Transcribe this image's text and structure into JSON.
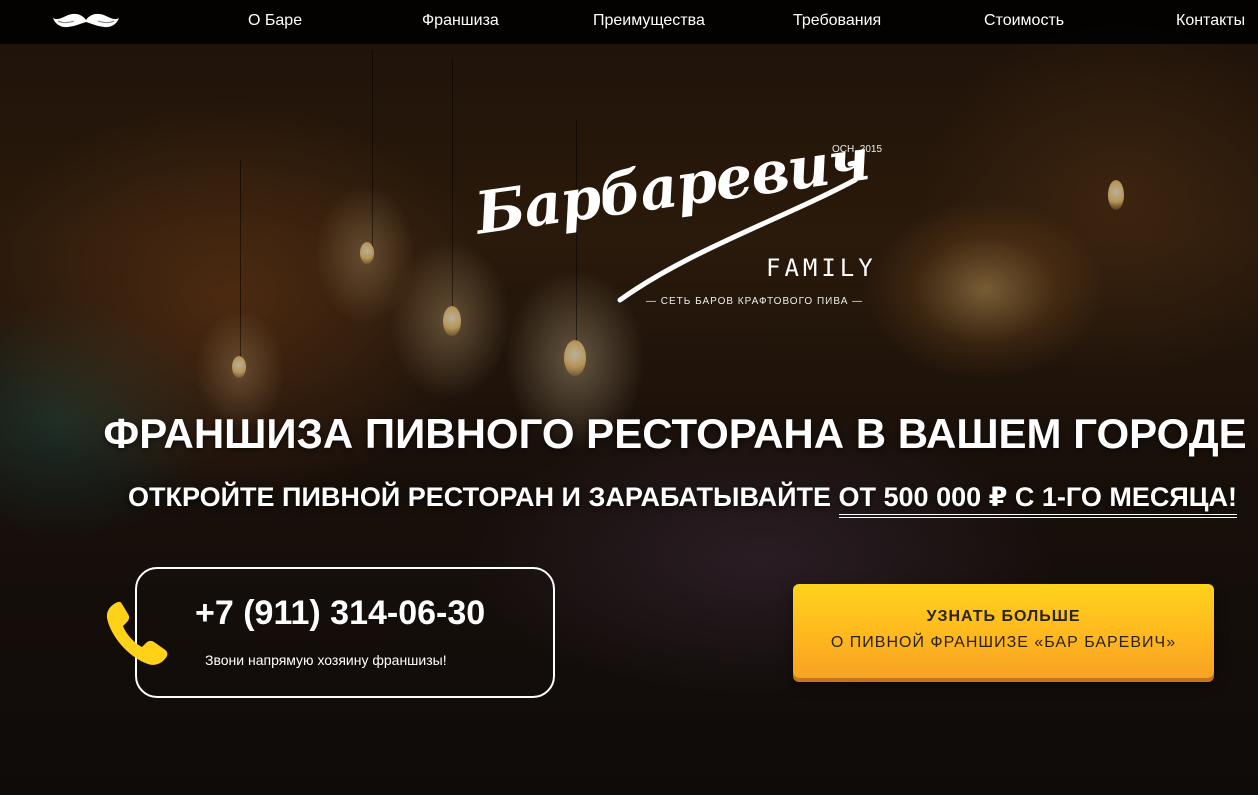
{
  "nav": {
    "items": [
      {
        "label": "О Баре"
      },
      {
        "label": "Франшиза"
      },
      {
        "label": "Преимущества"
      },
      {
        "label": "Требования"
      },
      {
        "label": "Стоимость"
      },
      {
        "label": "Контакты"
      }
    ],
    "logo_icon": "mustache-icon"
  },
  "brand": {
    "script_name": "Барбаревич",
    "established": "ОСН. 2015",
    "family": "FAMILY",
    "tagline": "— СЕТЬ БАРОВ КРАФТОВОГО ПИВА —"
  },
  "hero": {
    "headline": "ФРАНШИЗА ПИВНОГО РЕСТОРАНА В ВАШЕМ ГОРОДЕ",
    "sub_prefix": "ОТКРОЙТЕ ПИВНОЙ РЕСТОРАН И ЗАРАБАТЫВАЙТЕ ",
    "sub_highlight": "ОТ 500 000 ₽ С 1-ГО МЕСЯЦА!"
  },
  "contact": {
    "phone": "+7 (911) 314-06-30",
    "note": "Звони напрямую хозяину франшизы!",
    "icon": "phone-icon"
  },
  "cta": {
    "line1": "УЗНАТЬ БОЛЬШЕ",
    "line2": "О ПИВНОЙ ФРАНШИЗЕ «БАР БАРЕВИЧ»"
  },
  "colors": {
    "accent": "#ffc21f",
    "phone_icon": "#ffd21a",
    "nav_bg": "#000000"
  }
}
